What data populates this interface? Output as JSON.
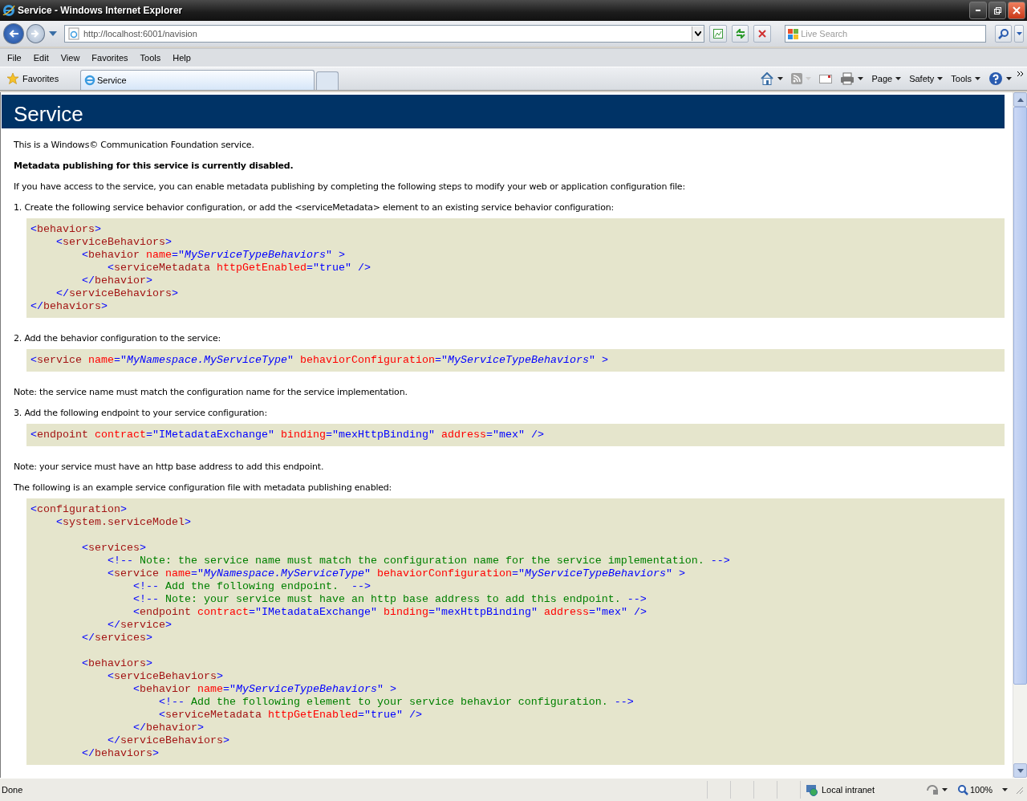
{
  "window": {
    "title": "Service - Windows Internet Explorer"
  },
  "address_bar": {
    "value": "http://localhost:6001/navision"
  },
  "search": {
    "placeholder": "Live Search"
  },
  "menu": [
    "File",
    "Edit",
    "View",
    "Favorites",
    "Tools",
    "Help"
  ],
  "favorites_button": {
    "label": "Favorites"
  },
  "tabs": [
    {
      "label": "Service",
      "selected": true
    }
  ],
  "command_bar": [
    {
      "label": "Page"
    },
    {
      "label": "Safety"
    },
    {
      "label": "Tools"
    }
  ],
  "page": {
    "title": "Service",
    "blocks": [
      {
        "kind": "para",
        "text": "This is a Windows© Communication Foundation service."
      },
      {
        "kind": "strong",
        "text": "Metadata publishing for this service is currently disabled."
      },
      {
        "kind": "para",
        "text": "If you have access to the service, you can enable metadata publishing by completing the following steps to modify your web or application configuration file:"
      },
      {
        "kind": "para",
        "text": "1. Create the following service behavior configuration, or add the <serviceMetadata> element to an existing service behavior configuration:"
      },
      {
        "kind": "code",
        "lines": [
          {
            "kind": "code",
            "tokens": [
              {
                "kind": "punct",
                "text": "<"
              },
              {
                "kind": "tag",
                "text": "behaviors"
              },
              {
                "kind": "punct",
                "text": ">"
              }
            ]
          },
          {
            "kind": "code",
            "tokens": [
              {
                "kind": "punct",
                "text": "    <"
              },
              {
                "kind": "tag",
                "text": "serviceBehaviors"
              },
              {
                "kind": "punct",
                "text": ">"
              }
            ]
          },
          {
            "kind": "code",
            "tokens": [
              {
                "kind": "punct",
                "text": "        <"
              },
              {
                "kind": "tag",
                "text": "behavior"
              },
              {
                "kind": "attr",
                "text": " name"
              },
              {
                "kind": "punct",
                "text": "=\""
              },
              {
                "kind": "ref",
                "text": "MyServiceTypeBehaviors"
              },
              {
                "kind": "punct",
                "text": "\" >"
              }
            ]
          },
          {
            "kind": "code",
            "tokens": [
              {
                "kind": "punct",
                "text": "            <"
              },
              {
                "kind": "tag",
                "text": "serviceMetadata"
              },
              {
                "kind": "attr",
                "text": " httpGetEnabled"
              },
              {
                "kind": "punct",
                "text": "=\""
              },
              {
                "kind": "value",
                "text": "true"
              },
              {
                "kind": "punct",
                "text": "\" />"
              }
            ]
          },
          {
            "kind": "code",
            "tokens": [
              {
                "kind": "punct",
                "text": "        </"
              },
              {
                "kind": "tag",
                "text": "behavior"
              },
              {
                "kind": "punct",
                "text": ">"
              }
            ]
          },
          {
            "kind": "code",
            "tokens": [
              {
                "kind": "punct",
                "text": "    </"
              },
              {
                "kind": "tag",
                "text": "serviceBehaviors"
              },
              {
                "kind": "punct",
                "text": ">"
              }
            ]
          },
          {
            "kind": "code",
            "tokens": [
              {
                "kind": "punct",
                "text": "</"
              },
              {
                "kind": "tag",
                "text": "behaviors"
              },
              {
                "kind": "punct",
                "text": ">"
              }
            ]
          }
        ]
      },
      {
        "kind": "para",
        "text": "2. Add the behavior configuration to the service:"
      },
      {
        "kind": "code",
        "lines": [
          {
            "kind": "code",
            "tokens": [
              {
                "kind": "punct",
                "text": "<"
              },
              {
                "kind": "tag",
                "text": "service"
              },
              {
                "kind": "attr",
                "text": " name"
              },
              {
                "kind": "punct",
                "text": "=\""
              },
              {
                "kind": "ref",
                "text": "MyNamespace.MyServiceType"
              },
              {
                "kind": "punct",
                "text": "\""
              },
              {
                "kind": "attr",
                "text": " behaviorConfiguration"
              },
              {
                "kind": "punct",
                "text": "=\""
              },
              {
                "kind": "ref",
                "text": "MyServiceTypeBehaviors"
              },
              {
                "kind": "punct",
                "text": "\" >"
              }
            ]
          }
        ]
      },
      {
        "kind": "para",
        "text": "Note: the service name must match the configuration name for the service implementation."
      },
      {
        "kind": "para",
        "text": "3. Add the following endpoint to your service configuration:"
      },
      {
        "kind": "code",
        "lines": [
          {
            "kind": "code",
            "tokens": [
              {
                "kind": "punct",
                "text": "<"
              },
              {
                "kind": "tag",
                "text": "endpoint"
              },
              {
                "kind": "attr",
                "text": " contract"
              },
              {
                "kind": "punct",
                "text": "=\""
              },
              {
                "kind": "value",
                "text": "IMetadataExchange"
              },
              {
                "kind": "punct",
                "text": "\""
              },
              {
                "kind": "attr",
                "text": " binding"
              },
              {
                "kind": "punct",
                "text": "=\""
              },
              {
                "kind": "value",
                "text": "mexHttpBinding"
              },
              {
                "kind": "punct",
                "text": "\""
              },
              {
                "kind": "attr",
                "text": " address"
              },
              {
                "kind": "punct",
                "text": "=\""
              },
              {
                "kind": "value",
                "text": "mex"
              },
              {
                "kind": "punct",
                "text": "\" />"
              }
            ]
          }
        ]
      },
      {
        "kind": "para",
        "text": "Note: your service must have an http base address to add this endpoint."
      },
      {
        "kind": "para",
        "text": "The following is an example service configuration file with metadata publishing enabled:"
      },
      {
        "kind": "code",
        "lines": [
          {
            "kind": "code",
            "tokens": [
              {
                "kind": "punct",
                "text": "<"
              },
              {
                "kind": "tag",
                "text": "configuration"
              },
              {
                "kind": "punct",
                "text": ">"
              }
            ]
          },
          {
            "kind": "code",
            "tokens": [
              {
                "kind": "punct",
                "text": "    <"
              },
              {
                "kind": "tag",
                "text": "system.serviceModel"
              },
              {
                "kind": "punct",
                "text": ">"
              }
            ]
          },
          {
            "kind": "blank"
          },
          {
            "kind": "code",
            "tokens": [
              {
                "kind": "punct",
                "text": "        <"
              },
              {
                "kind": "tag",
                "text": "services"
              },
              {
                "kind": "punct",
                "text": ">"
              }
            ]
          },
          {
            "kind": "code",
            "tokens": [
              {
                "kind": "punct",
                "text": "            <!--"
              },
              {
                "kind": "comment",
                "text": " Note: the service name must match the configuration name for the service implementation. "
              },
              {
                "kind": "punct",
                "text": "-->"
              }
            ]
          },
          {
            "kind": "code",
            "tokens": [
              {
                "kind": "punct",
                "text": "            <"
              },
              {
                "kind": "tag",
                "text": "service"
              },
              {
                "kind": "attr",
                "text": " name"
              },
              {
                "kind": "punct",
                "text": "=\""
              },
              {
                "kind": "ref",
                "text": "MyNamespace.MyServiceType"
              },
              {
                "kind": "punct",
                "text": "\""
              },
              {
                "kind": "attr",
                "text": " behaviorConfiguration"
              },
              {
                "kind": "punct",
                "text": "=\""
              },
              {
                "kind": "ref",
                "text": "MyServiceTypeBehaviors"
              },
              {
                "kind": "punct",
                "text": "\" >"
              }
            ]
          },
          {
            "kind": "code",
            "tokens": [
              {
                "kind": "punct",
                "text": "                <!--"
              },
              {
                "kind": "comment",
                "text": " Add the following endpoint.  "
              },
              {
                "kind": "punct",
                "text": "-->"
              }
            ]
          },
          {
            "kind": "code",
            "tokens": [
              {
                "kind": "punct",
                "text": "                <!--"
              },
              {
                "kind": "comment",
                "text": " Note: your service must have an http base address to add this endpoint. "
              },
              {
                "kind": "punct",
                "text": "-->"
              }
            ]
          },
          {
            "kind": "code",
            "tokens": [
              {
                "kind": "punct",
                "text": "                <"
              },
              {
                "kind": "tag",
                "text": "endpoint"
              },
              {
                "kind": "attr",
                "text": " contract"
              },
              {
                "kind": "punct",
                "text": "=\""
              },
              {
                "kind": "value",
                "text": "IMetadataExchange"
              },
              {
                "kind": "punct",
                "text": "\""
              },
              {
                "kind": "attr",
                "text": " binding"
              },
              {
                "kind": "punct",
                "text": "=\""
              },
              {
                "kind": "value",
                "text": "mexHttpBinding"
              },
              {
                "kind": "punct",
                "text": "\""
              },
              {
                "kind": "attr",
                "text": " address"
              },
              {
                "kind": "punct",
                "text": "=\""
              },
              {
                "kind": "value",
                "text": "mex"
              },
              {
                "kind": "punct",
                "text": "\" />"
              }
            ]
          },
          {
            "kind": "code",
            "tokens": [
              {
                "kind": "punct",
                "text": "            </"
              },
              {
                "kind": "tag",
                "text": "service"
              },
              {
                "kind": "punct",
                "text": ">"
              }
            ]
          },
          {
            "kind": "code",
            "tokens": [
              {
                "kind": "punct",
                "text": "        </"
              },
              {
                "kind": "tag",
                "text": "services"
              },
              {
                "kind": "punct",
                "text": ">"
              }
            ]
          },
          {
            "kind": "blank"
          },
          {
            "kind": "code",
            "tokens": [
              {
                "kind": "punct",
                "text": "        <"
              },
              {
                "kind": "tag",
                "text": "behaviors"
              },
              {
                "kind": "punct",
                "text": ">"
              }
            ]
          },
          {
            "kind": "code",
            "tokens": [
              {
                "kind": "punct",
                "text": "            <"
              },
              {
                "kind": "tag",
                "text": "serviceBehaviors"
              },
              {
                "kind": "punct",
                "text": ">"
              }
            ]
          },
          {
            "kind": "code",
            "tokens": [
              {
                "kind": "punct",
                "text": "                <"
              },
              {
                "kind": "tag",
                "text": "behavior"
              },
              {
                "kind": "attr",
                "text": " name"
              },
              {
                "kind": "punct",
                "text": "=\""
              },
              {
                "kind": "ref",
                "text": "MyServiceTypeBehaviors"
              },
              {
                "kind": "punct",
                "text": "\" >"
              }
            ]
          },
          {
            "kind": "code",
            "tokens": [
              {
                "kind": "punct",
                "text": "                    <!--"
              },
              {
                "kind": "comment",
                "text": " Add the following element to your service behavior configuration. "
              },
              {
                "kind": "punct",
                "text": "-->"
              }
            ]
          },
          {
            "kind": "code",
            "tokens": [
              {
                "kind": "punct",
                "text": "                    <"
              },
              {
                "kind": "tag",
                "text": "serviceMetadata"
              },
              {
                "kind": "attr",
                "text": " httpGetEnabled"
              },
              {
                "kind": "punct",
                "text": "=\""
              },
              {
                "kind": "value",
                "text": "true"
              },
              {
                "kind": "punct",
                "text": "\" />"
              }
            ]
          },
          {
            "kind": "code",
            "tokens": [
              {
                "kind": "punct",
                "text": "                </"
              },
              {
                "kind": "tag",
                "text": "behavior"
              },
              {
                "kind": "punct",
                "text": ">"
              }
            ]
          },
          {
            "kind": "code",
            "tokens": [
              {
                "kind": "punct",
                "text": "            </"
              },
              {
                "kind": "tag",
                "text": "serviceBehaviors"
              },
              {
                "kind": "punct",
                "text": ">"
              }
            ]
          },
          {
            "kind": "code",
            "tokens": [
              {
                "kind": "punct",
                "text": "        </"
              },
              {
                "kind": "tag",
                "text": "behaviors"
              },
              {
                "kind": "punct",
                "text": ">"
              }
            ]
          }
        ]
      }
    ]
  },
  "status_bar": {
    "text": "Done",
    "zone": "Local intranet",
    "zoom": "100%"
  }
}
